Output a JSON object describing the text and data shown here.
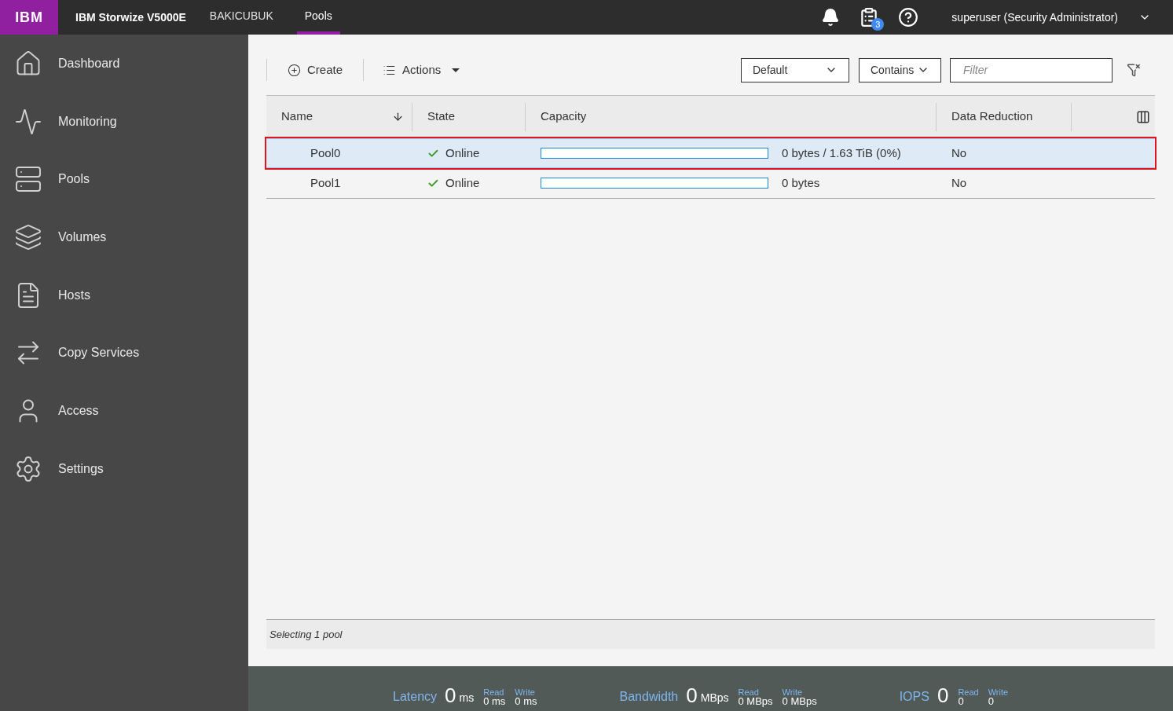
{
  "header": {
    "logo": "IBM",
    "product": "IBM Storwize V5000E",
    "tabs": [
      {
        "label": "BAKICUBUK",
        "selected": false
      },
      {
        "label": "Pools",
        "selected": true
      }
    ],
    "task_badge": "3",
    "user": "superuser (Security Administrator)"
  },
  "sidebar": {
    "items": [
      {
        "label": "Dashboard",
        "selected": false
      },
      {
        "label": "Monitoring",
        "selected": false
      },
      {
        "label": "Pools",
        "selected": false
      },
      {
        "label": "Volumes",
        "selected": false
      },
      {
        "label": "Hosts",
        "selected": false
      },
      {
        "label": "Copy Services",
        "selected": false
      },
      {
        "label": "Access",
        "selected": false
      },
      {
        "label": "Settings",
        "selected": false
      }
    ]
  },
  "toolbar": {
    "create": "Create",
    "actions": "Actions",
    "view_select": "Default",
    "match_select": "Contains",
    "filter": {
      "placeholder": "Filter"
    }
  },
  "table": {
    "columns": [
      "Name",
      "State",
      "Capacity",
      "Data Reduction"
    ],
    "rows": [
      {
        "name": "Pool0",
        "state": "Online",
        "level": 0,
        "capacity": "0 bytes / 1.63 TiB (0%)",
        "data_reduction": "No",
        "selected": true
      },
      {
        "name": "Pool1",
        "state": "Online",
        "level": 0,
        "capacity": "0 bytes",
        "data_reduction": "No",
        "selected": false
      }
    ]
  },
  "status_bar": "Selecting 1 pool",
  "metrics": [
    {
      "label": "Latency",
      "value": "0",
      "unit": "ms",
      "read_label": "Read",
      "read": "0 ms",
      "write_label": "Write",
      "write": "0 ms"
    },
    {
      "label": "Bandwidth",
      "value": "0",
      "unit": "MBps",
      "read_label": "Read",
      "read": "0 MBps",
      "write_label": "Write",
      "write": "0 MBps"
    },
    {
      "label": "IOPS",
      "value": "0",
      "read_label": "Read",
      "read": "0",
      "write_label": "Write",
      "write": "0"
    }
  ]
}
